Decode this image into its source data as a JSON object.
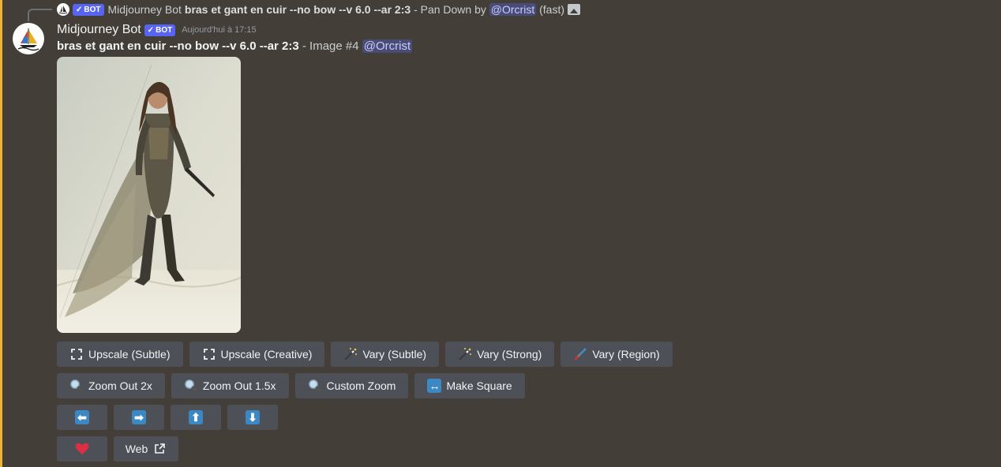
{
  "reply": {
    "author": "Midjourney Bot",
    "bot_tag": "BOT",
    "prompt": "bras et gant en cuir --no bow --v 6.0 --ar 2:3",
    "suffix": "- Pan Down by",
    "mention": "@Orcrist",
    "mode": "(fast)"
  },
  "message": {
    "author": "Midjourney Bot",
    "bot_tag": "BOT",
    "timestamp": "Aujourd'hui à 17:15",
    "prompt": "bras et gant en cuir --no bow --v 6.0 --ar 2:3",
    "image_label": "- Image #4",
    "mention": "@Orcrist"
  },
  "buttons": {
    "row1": [
      {
        "label": "Upscale (Subtle)",
        "icon": "expand-icon"
      },
      {
        "label": "Upscale (Creative)",
        "icon": "expand-icon"
      },
      {
        "label": "Vary (Subtle)",
        "icon": "magic-wand-icon"
      },
      {
        "label": "Vary (Strong)",
        "icon": "magic-wand-icon"
      },
      {
        "label": "Vary (Region)",
        "icon": "paintbrush-icon"
      }
    ],
    "row2": [
      {
        "label": "Zoom Out 2x",
        "icon": "magnifier-icon"
      },
      {
        "label": "Zoom Out 1.5x",
        "icon": "magnifier-icon"
      },
      {
        "label": "Custom Zoom",
        "icon": "magnifier-icon"
      },
      {
        "label": "Make Square",
        "icon": "left-right-arrow-icon"
      }
    ],
    "row3": [
      {
        "icon": "arrow-left-icon",
        "glyph": "⬅"
      },
      {
        "icon": "arrow-right-icon",
        "glyph": "➡"
      },
      {
        "icon": "arrow-up-icon",
        "glyph": "⬆"
      },
      {
        "icon": "arrow-down-icon",
        "glyph": "⬇"
      }
    ],
    "row4": [
      {
        "icon": "heart-icon"
      },
      {
        "label": "Web",
        "icon": "external-link-icon"
      }
    ]
  },
  "colors": {
    "background": "#433f38",
    "button": "#4e5058",
    "bot_tag": "#5865f2",
    "accent_bar": "#f0b232",
    "arrow_blue": "#3b88c3",
    "heart": "#dd2e44"
  }
}
